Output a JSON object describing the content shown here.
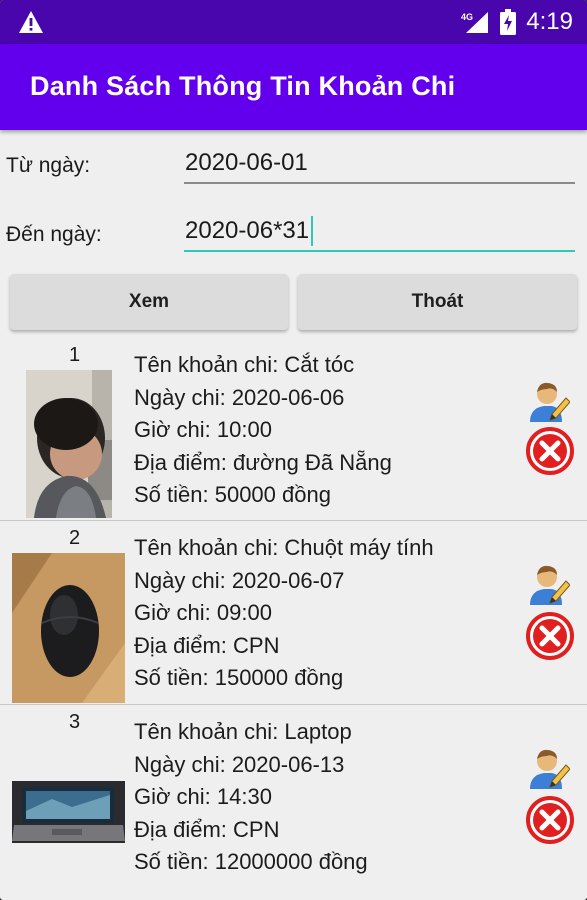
{
  "status_bar": {
    "time": "4:19",
    "network": "4G",
    "icons": [
      "warning-icon",
      "signal-icon",
      "battery-charging-icon"
    ]
  },
  "app_bar": {
    "title": "Danh Sách Thông Tin Khoản Chi"
  },
  "filter": {
    "from_label": "Từ ngày:",
    "from_value": "2020-06-01",
    "to_label": "Đến ngày:",
    "to_value": "2020-06*31"
  },
  "buttons": {
    "view": "Xem",
    "exit": "Thoát"
  },
  "expenses": [
    {
      "index": "1",
      "name": "Tên khoản chi: Cắt tóc",
      "date": "Ngày chi: 2020-06-06",
      "time": "Giờ chi: 10:00",
      "place": "Địa điểm: đường Đã Nẵng",
      "amount": "Số tiền: 50000 đồng",
      "photo": "haircut-photo"
    },
    {
      "index": "2",
      "name": "Tên khoản chi: Chuột máy tính",
      "date": "Ngày chi: 2020-06-07",
      "time": "Giờ chi: 09:00",
      "place": "Địa điểm: CPN",
      "amount": "Số tiền: 150000 đồng",
      "photo": "mouse-photo"
    },
    {
      "index": "3",
      "name": "Tên khoản chi: Laptop",
      "date": "Ngày chi: 2020-06-13",
      "time": "Giờ chi: 14:30",
      "place": "Địa điểm: CPN",
      "amount": "Số tiền: 12000000 đồng",
      "photo": "laptop-photo"
    }
  ],
  "colors": {
    "status_bar": "#4a06ad",
    "app_bar": "#6200ee",
    "field_focus": "#2fc7b7",
    "delete_red": "#e02020"
  }
}
